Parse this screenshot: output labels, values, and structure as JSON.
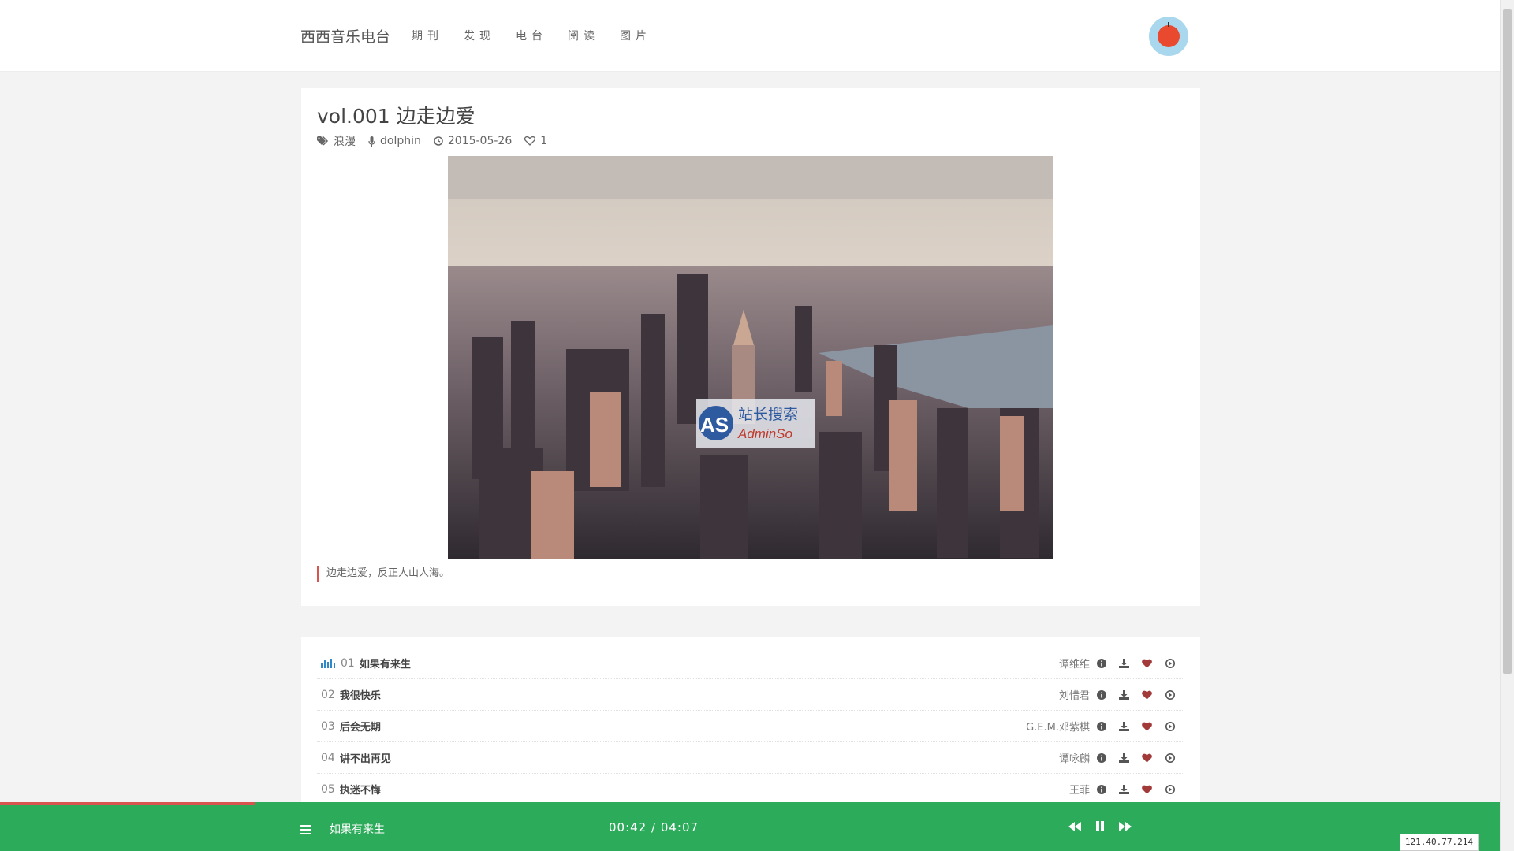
{
  "header": {
    "brand": "西西音乐电台",
    "nav": [
      "期刊",
      "发现",
      "电台",
      "阅读",
      "图片"
    ]
  },
  "article": {
    "title": "vol.001 边走边爱",
    "meta": {
      "tag": "浪漫",
      "author": "dolphin",
      "date": "2015-05-26",
      "likes": "1"
    },
    "quote": "边走边爱，反正人山人海。",
    "watermark": {
      "big": "AS",
      "cn": "站长搜索",
      "en": "AdminSo"
    }
  },
  "tracks": [
    {
      "num": "01",
      "title": "如果有来生",
      "artist": "谭维维",
      "playing": true
    },
    {
      "num": "02",
      "title": "我很快乐",
      "artist": "刘惜君",
      "playing": false
    },
    {
      "num": "03",
      "title": "后会无期",
      "artist": "G.E.M.邓紫棋",
      "playing": false
    },
    {
      "num": "04",
      "title": "讲不出再见",
      "artist": "谭咏麟",
      "playing": false
    },
    {
      "num": "05",
      "title": "执迷不悔",
      "artist": "王菲",
      "playing": false
    }
  ],
  "player": {
    "now_playing": "如果有来生",
    "time": "00:42 / 04:07",
    "progress": 0.17
  },
  "ip": "121.40.77.214",
  "colors": {
    "accent_green": "#2cab5a",
    "heart_red": "#a33a3a",
    "quote_bar": "#d9534f",
    "avatar_bg": "#a9d7ee"
  }
}
